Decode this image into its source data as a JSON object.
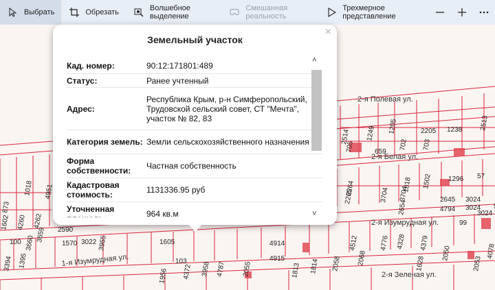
{
  "toolbar": {
    "select_label": "Выбрать",
    "crop_label": "Обрезать",
    "magic_select_label": "Волшебное выделение",
    "mixed_reality_label": "Смешанная реальность",
    "view3d_label": "Трехмерное представление"
  },
  "popup": {
    "title": "Земельный участок",
    "close_glyph": "×",
    "rows": [
      {
        "label": "Кад. номер:",
        "value": "90:12:171801:489"
      },
      {
        "label": "Статус:",
        "value": "Ранее учтенный"
      },
      {
        "label": "Адрес:",
        "value": "Республика Крым, р-н Симферопольский, Трудовской сельский совет, СТ \"Мечта\", участок № 82, 83"
      },
      {
        "label": "Категория земель:",
        "value": "Земли сельскохозяйственного назначения"
      },
      {
        "label": "Форма собственности:",
        "value": "Частная собственность"
      },
      {
        "label": "Кадастровая стоимость:",
        "value": "1131336.95 руб"
      },
      {
        "label": "Уточненная площадь:",
        "value": "964 кв.м"
      }
    ]
  },
  "map": {
    "streets": {
      "s1": "2-я Полевая ул.",
      "s2": "2-я Белая ул.",
      "s3": "2-я Изумрудная ул.",
      "s4": "1-я Изумрудная ул.",
      "s5": "2-я Зеленая ул."
    },
    "parcel_labels": [
      "2514",
      "1249",
      "1205",
      "2205",
      "1238",
      "2513",
      "705",
      "659",
      "702",
      "703",
      "2264",
      "1818",
      "1502",
      "1296",
      "57",
      "2265",
      "3704",
      "3704",
      "2645",
      "3024",
      "3024",
      "4794",
      "2654",
      "3024",
      "5",
      "4951",
      "1018",
      "873",
      "4260",
      "4262",
      "1602",
      "2590",
      "1570",
      "3022",
      "3955",
      "3394",
      "1395",
      "1605",
      "1956",
      "4372",
      "3958",
      "4787",
      "2055",
      "4914",
      "4915",
      "1813",
      "1814",
      "2058",
      "2068",
      "4512",
      "4776",
      "4328",
      "4379",
      "2050",
      "1628",
      "2053",
      "4078",
      "99",
      "3659",
      "3660",
      "100",
      "103"
    ]
  },
  "colors": {
    "parcel_line": "#d9243a",
    "building_fill": "#e24a55",
    "toolbar_bg": "#e8eef6",
    "map_bg": "#fbf5f2"
  }
}
